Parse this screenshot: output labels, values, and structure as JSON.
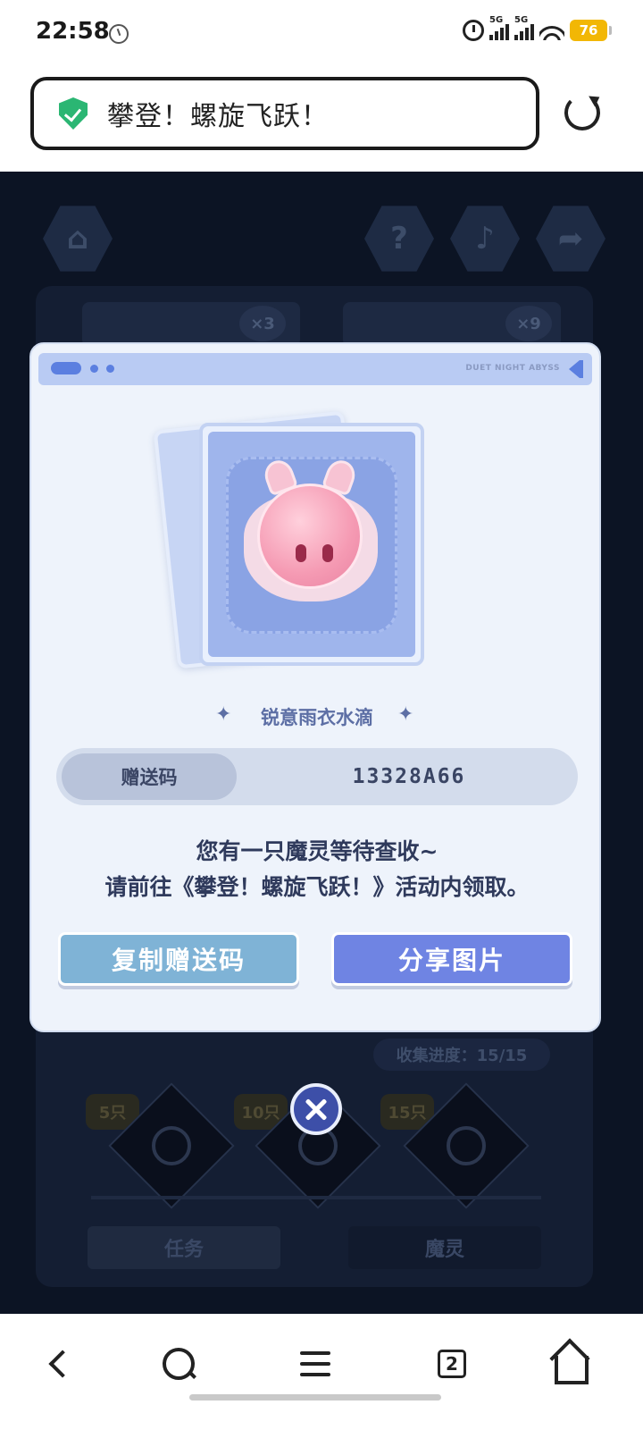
{
  "status_bar": {
    "time": "22:58",
    "signal1_label": "5G",
    "signal2_label": "5G",
    "battery": "76"
  },
  "browser": {
    "page_title": "攀登！螺旋飞跃！",
    "tab_count": "2"
  },
  "background": {
    "help_symbol": "?",
    "music_symbol": "♪",
    "count_badge_1": "×3",
    "count_badge_2": "×9",
    "progress": "收集进度：15/15",
    "milestones": [
      "5只",
      "10只",
      "15只"
    ],
    "tab_tasks": "任务",
    "tab_spirits": "魔灵"
  },
  "modal": {
    "brand": "DUET NIGHT ABYSS",
    "character_name": "锐意雨衣水滴",
    "code_label": "赠送码",
    "code_value": "13328A66",
    "message_line1": "您有一只魔灵等待查收~",
    "message_line2": "请前往《攀登！螺旋飞跃！》活动内领取。",
    "copy_button": "复制赠送码",
    "share_button": "分享图片"
  },
  "colors": {
    "accent": "#6f84e3",
    "copy_button": "#7fb3d6",
    "secure": "#2bb673",
    "battery": "#f2b705"
  },
  "icons": [
    "shield-check-icon",
    "reload-icon",
    "alarm-icon",
    "wifi-icon",
    "close-icon",
    "back-icon",
    "search-icon",
    "menu-icon",
    "tabs-icon",
    "home-icon"
  ]
}
